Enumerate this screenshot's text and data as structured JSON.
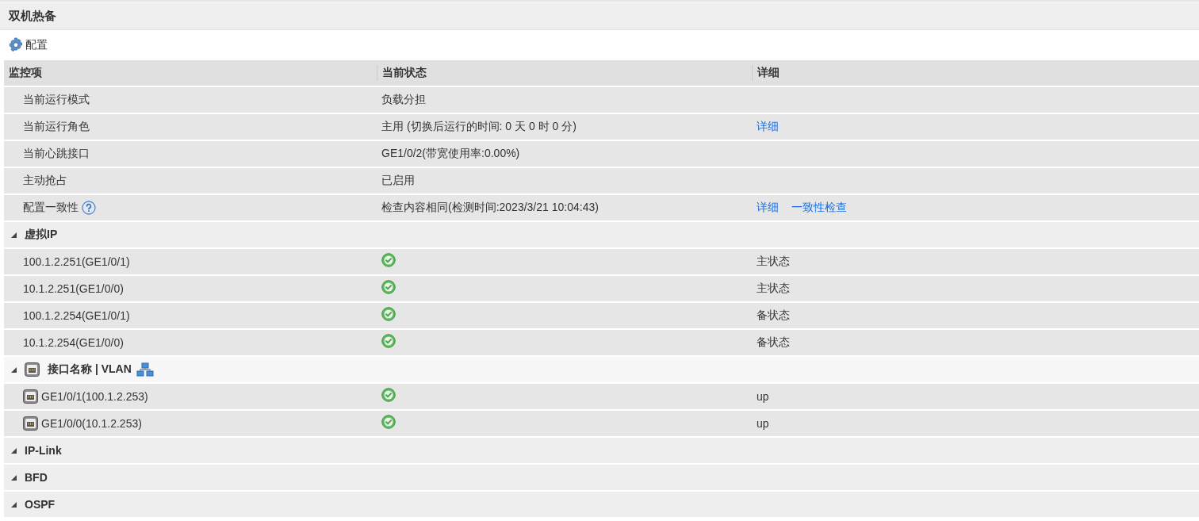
{
  "title": "双机热备",
  "toolbar": {
    "label": "配置"
  },
  "table": {
    "columns": [
      "监控项",
      "当前状态",
      "详细"
    ],
    "rows": [
      {
        "kind": "item",
        "name": "当前运行模式",
        "status": "负载分担",
        "links": []
      },
      {
        "kind": "item",
        "name": "当前运行角色",
        "status": "主用 (切换后运行的时间: 0 天 0 时 0 分)",
        "links": [
          "详细"
        ]
      },
      {
        "kind": "item",
        "name": "当前心跳接口",
        "status": "GE1/0/2(带宽使用率:0.00%)",
        "links": []
      },
      {
        "kind": "item",
        "name": "主动抢占",
        "status": "已启用",
        "links": []
      },
      {
        "kind": "item",
        "name": "配置一致性",
        "help": true,
        "status": "检查内容相同(检测时间:2023/3/21 10:04:43)",
        "links": [
          "详细",
          "一致性检查"
        ]
      },
      {
        "kind": "group",
        "label": "虚拟IP",
        "expanded": true,
        "children": [
          {
            "name": "100.1.2.251(GE1/0/1)",
            "ok": true,
            "detail": "主状态"
          },
          {
            "name": "10.1.2.251(GE1/0/0)",
            "ok": true,
            "detail": "主状态"
          },
          {
            "name": "100.1.2.254(GE1/0/1)",
            "ok": true,
            "detail": "备状态"
          },
          {
            "name": "10.1.2.254(GE1/0/0)",
            "ok": true,
            "detail": "备状态"
          }
        ]
      },
      {
        "kind": "interface_group",
        "label": "接口名称 | VLAN",
        "expanded": true,
        "children": [
          {
            "name": "GE1/0/1(100.1.2.253)",
            "ok": true,
            "detail": "up"
          },
          {
            "name": "GE1/0/0(10.1.2.253)",
            "ok": true,
            "detail": "up"
          }
        ]
      },
      {
        "kind": "group",
        "label": "IP-Link",
        "expanded": true
      },
      {
        "kind": "group",
        "label": "BFD",
        "expanded": true
      },
      {
        "kind": "group",
        "label": "OSPF",
        "expanded": true
      }
    ]
  }
}
